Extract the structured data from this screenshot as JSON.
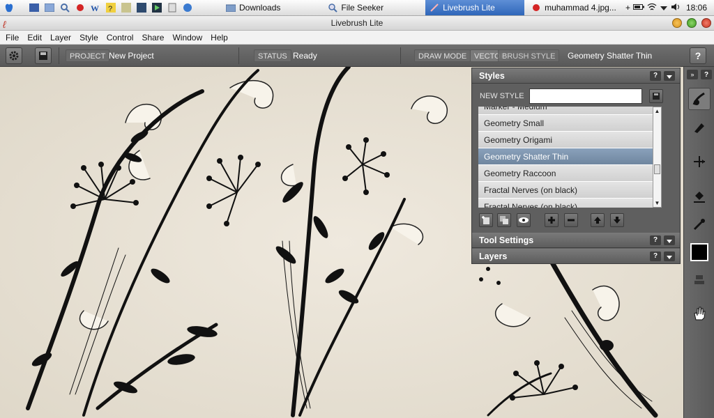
{
  "taskbar": {
    "items": [
      {
        "label": "Downloads",
        "icon": "folder-icon"
      },
      {
        "label": "File Seeker",
        "icon": "search-icon"
      },
      {
        "label": "Livebrush Lite",
        "icon": "livebrush-icon",
        "active": true
      },
      {
        "label": "muhammad 4.jpg...",
        "icon": "image-viewer-icon"
      }
    ],
    "overflow": "+",
    "clock": "18:06"
  },
  "window": {
    "title": "Livebrush Lite"
  },
  "menu": [
    "File",
    "Edit",
    "Layer",
    "Style",
    "Control",
    "Share",
    "Window",
    "Help"
  ],
  "toolbar": {
    "project_label": "PROJECT",
    "project_value": "New Project",
    "status_label": "STATUS",
    "status_value": "Ready",
    "drawmode_label": "DRAW MODE",
    "vector_label": "VECTOR",
    "brushstyle_label": "BRUSH STYLE",
    "brushstyle_value": "Geometry Shatter Thin",
    "help": "?"
  },
  "styles_panel": {
    "title": "Styles",
    "new_style_label": "NEW STYLE",
    "new_style_value": "",
    "items": [
      {
        "label": "Marker - Medium"
      },
      {
        "label": "Geometry Small"
      },
      {
        "label": "Geometry Origami"
      },
      {
        "label": "Geometry Shatter Thin",
        "selected": true
      },
      {
        "label": "Geometry Raccoon"
      },
      {
        "label": "Fractal Nerves (on black)"
      },
      {
        "label": "Fractal Nerves (on black)"
      }
    ]
  },
  "tool_settings_panel": {
    "title": "Tool Settings"
  },
  "layers_panel": {
    "title": "Layers"
  },
  "colors": {
    "accent": "#2f66b9",
    "selected_row": "#7b92ac",
    "panel_bg": "#5f5f5f",
    "canvas_bg": "#ebe5d9"
  }
}
